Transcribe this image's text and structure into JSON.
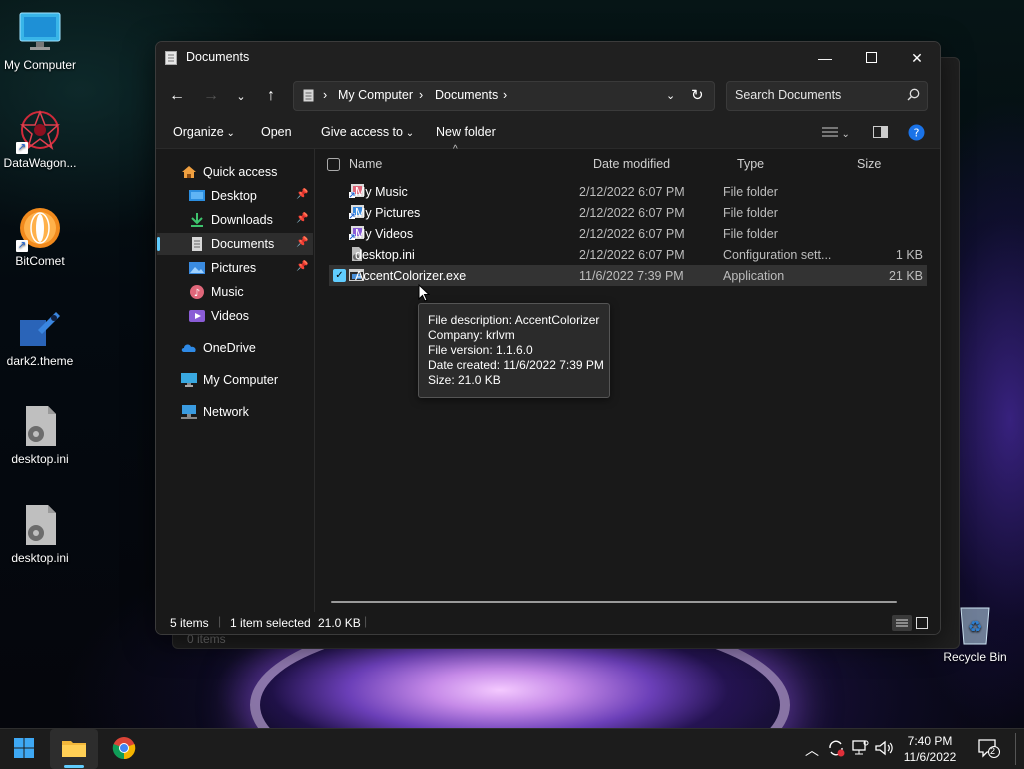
{
  "desktop": {
    "icons": [
      {
        "label": "My Computer"
      },
      {
        "label": "DataWagon..."
      },
      {
        "label": "BitComet"
      },
      {
        "label": "dark2.theme"
      },
      {
        "label": "desktop.ini"
      },
      {
        "label": "desktop.ini"
      },
      {
        "label": "Recycle Bin"
      }
    ]
  },
  "back_window": {
    "status": "0 items"
  },
  "window": {
    "title": "Documents",
    "breadcrumb": [
      "My Computer",
      "Documents"
    ],
    "search_placeholder": "Search Documents",
    "toolbar": {
      "organize": "Organize",
      "open": "Open",
      "give_access": "Give access to",
      "new_folder": "New folder"
    },
    "nav": {
      "quick_access": "Quick access",
      "desktop": "Desktop",
      "downloads": "Downloads",
      "documents": "Documents",
      "pictures": "Pictures",
      "music": "Music",
      "videos": "Videos",
      "onedrive": "OneDrive",
      "my_computer": "My Computer",
      "network": "Network"
    },
    "columns": {
      "name": "Name",
      "date": "Date modified",
      "type": "Type",
      "size": "Size"
    },
    "files": [
      {
        "name": "My Music",
        "date": "2/12/2022 6:07 PM",
        "type": "File folder",
        "size": "",
        "icon": "music-folder-icon"
      },
      {
        "name": "My Pictures",
        "date": "2/12/2022 6:07 PM",
        "type": "File folder",
        "size": "",
        "icon": "pictures-folder-icon"
      },
      {
        "name": "My Videos",
        "date": "2/12/2022 6:07 PM",
        "type": "File folder",
        "size": "",
        "icon": "videos-folder-icon"
      },
      {
        "name": "desktop.ini",
        "date": "2/12/2022 6:07 PM",
        "type": "Configuration sett...",
        "size": "1 KB",
        "icon": "settings-file-icon"
      },
      {
        "name": "AccentColorizer.exe",
        "date": "11/6/2022 7:39 PM",
        "type": "Application",
        "size": "21 KB",
        "icon": "application-icon"
      }
    ],
    "tooltip": [
      "File description: AccentColorizer",
      "Company: krlvm",
      "File version: 1.1.6.0",
      "Date created: 11/6/2022 7:39 PM",
      "Size: 21.0 KB"
    ],
    "status": {
      "items": "5 items",
      "selected": "1 item selected",
      "size": "21.0 KB"
    }
  },
  "taskbar": {
    "time": "7:40 PM",
    "date": "11/6/2022",
    "notification_count": "2"
  },
  "colors": {
    "accent": "#60cdff",
    "window_bg": "#191919",
    "chrome_bg": "#202020",
    "taskbar_bg": "#1c1c1c"
  }
}
